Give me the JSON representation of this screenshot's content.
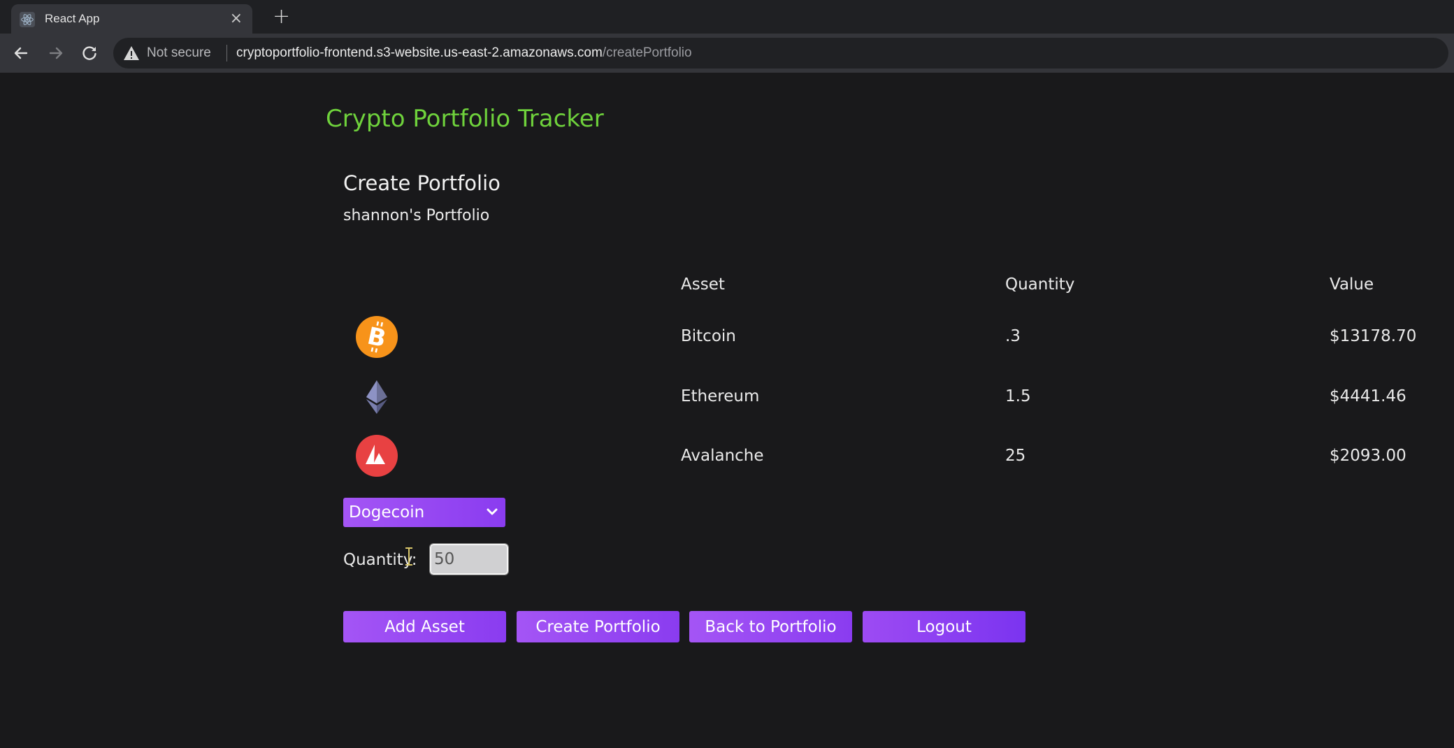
{
  "browser": {
    "tab_title": "React App",
    "close_glyph": "×",
    "new_tab_glyph": "+",
    "security_label": "Not secure",
    "url_host": "cryptoportfolio-frontend.s3-website.us-east-2.amazonaws.com",
    "url_path": "/createPortfolio",
    "icons": [
      "react-favicon",
      "back-arrow-icon",
      "forward-arrow-icon",
      "reload-icon",
      "warning-icon"
    ]
  },
  "app": {
    "title": "Crypto Portfolio Tracker",
    "title_color": "#6fd23c",
    "accent": "#9a4af4"
  },
  "portfolio": {
    "heading": "Create Portfolio",
    "name": "shannon's Portfolio",
    "columns": {
      "asset": "Asset",
      "quantity": "Quantity",
      "value": "Value"
    },
    "assets": [
      {
        "icon": "bitcoin-icon",
        "asset": "Bitcoin",
        "quantity": ".3",
        "value": "$13178.70"
      },
      {
        "icon": "ethereum-icon",
        "asset": "Ethereum",
        "quantity": "1.5",
        "value": "$4441.46"
      },
      {
        "icon": "avalanche-icon",
        "asset": "Avalanche",
        "quantity": "25",
        "value": "$2093.00"
      }
    ]
  },
  "form": {
    "selected_coin": "Dogecoin",
    "quantity_label": "Quantity:",
    "quantity_value": "50"
  },
  "buttons": {
    "add_asset": "Add Asset",
    "create_portfolio": "Create Portfolio",
    "back_to_portfolio": "Back to Portfolio",
    "logout": "Logout"
  }
}
